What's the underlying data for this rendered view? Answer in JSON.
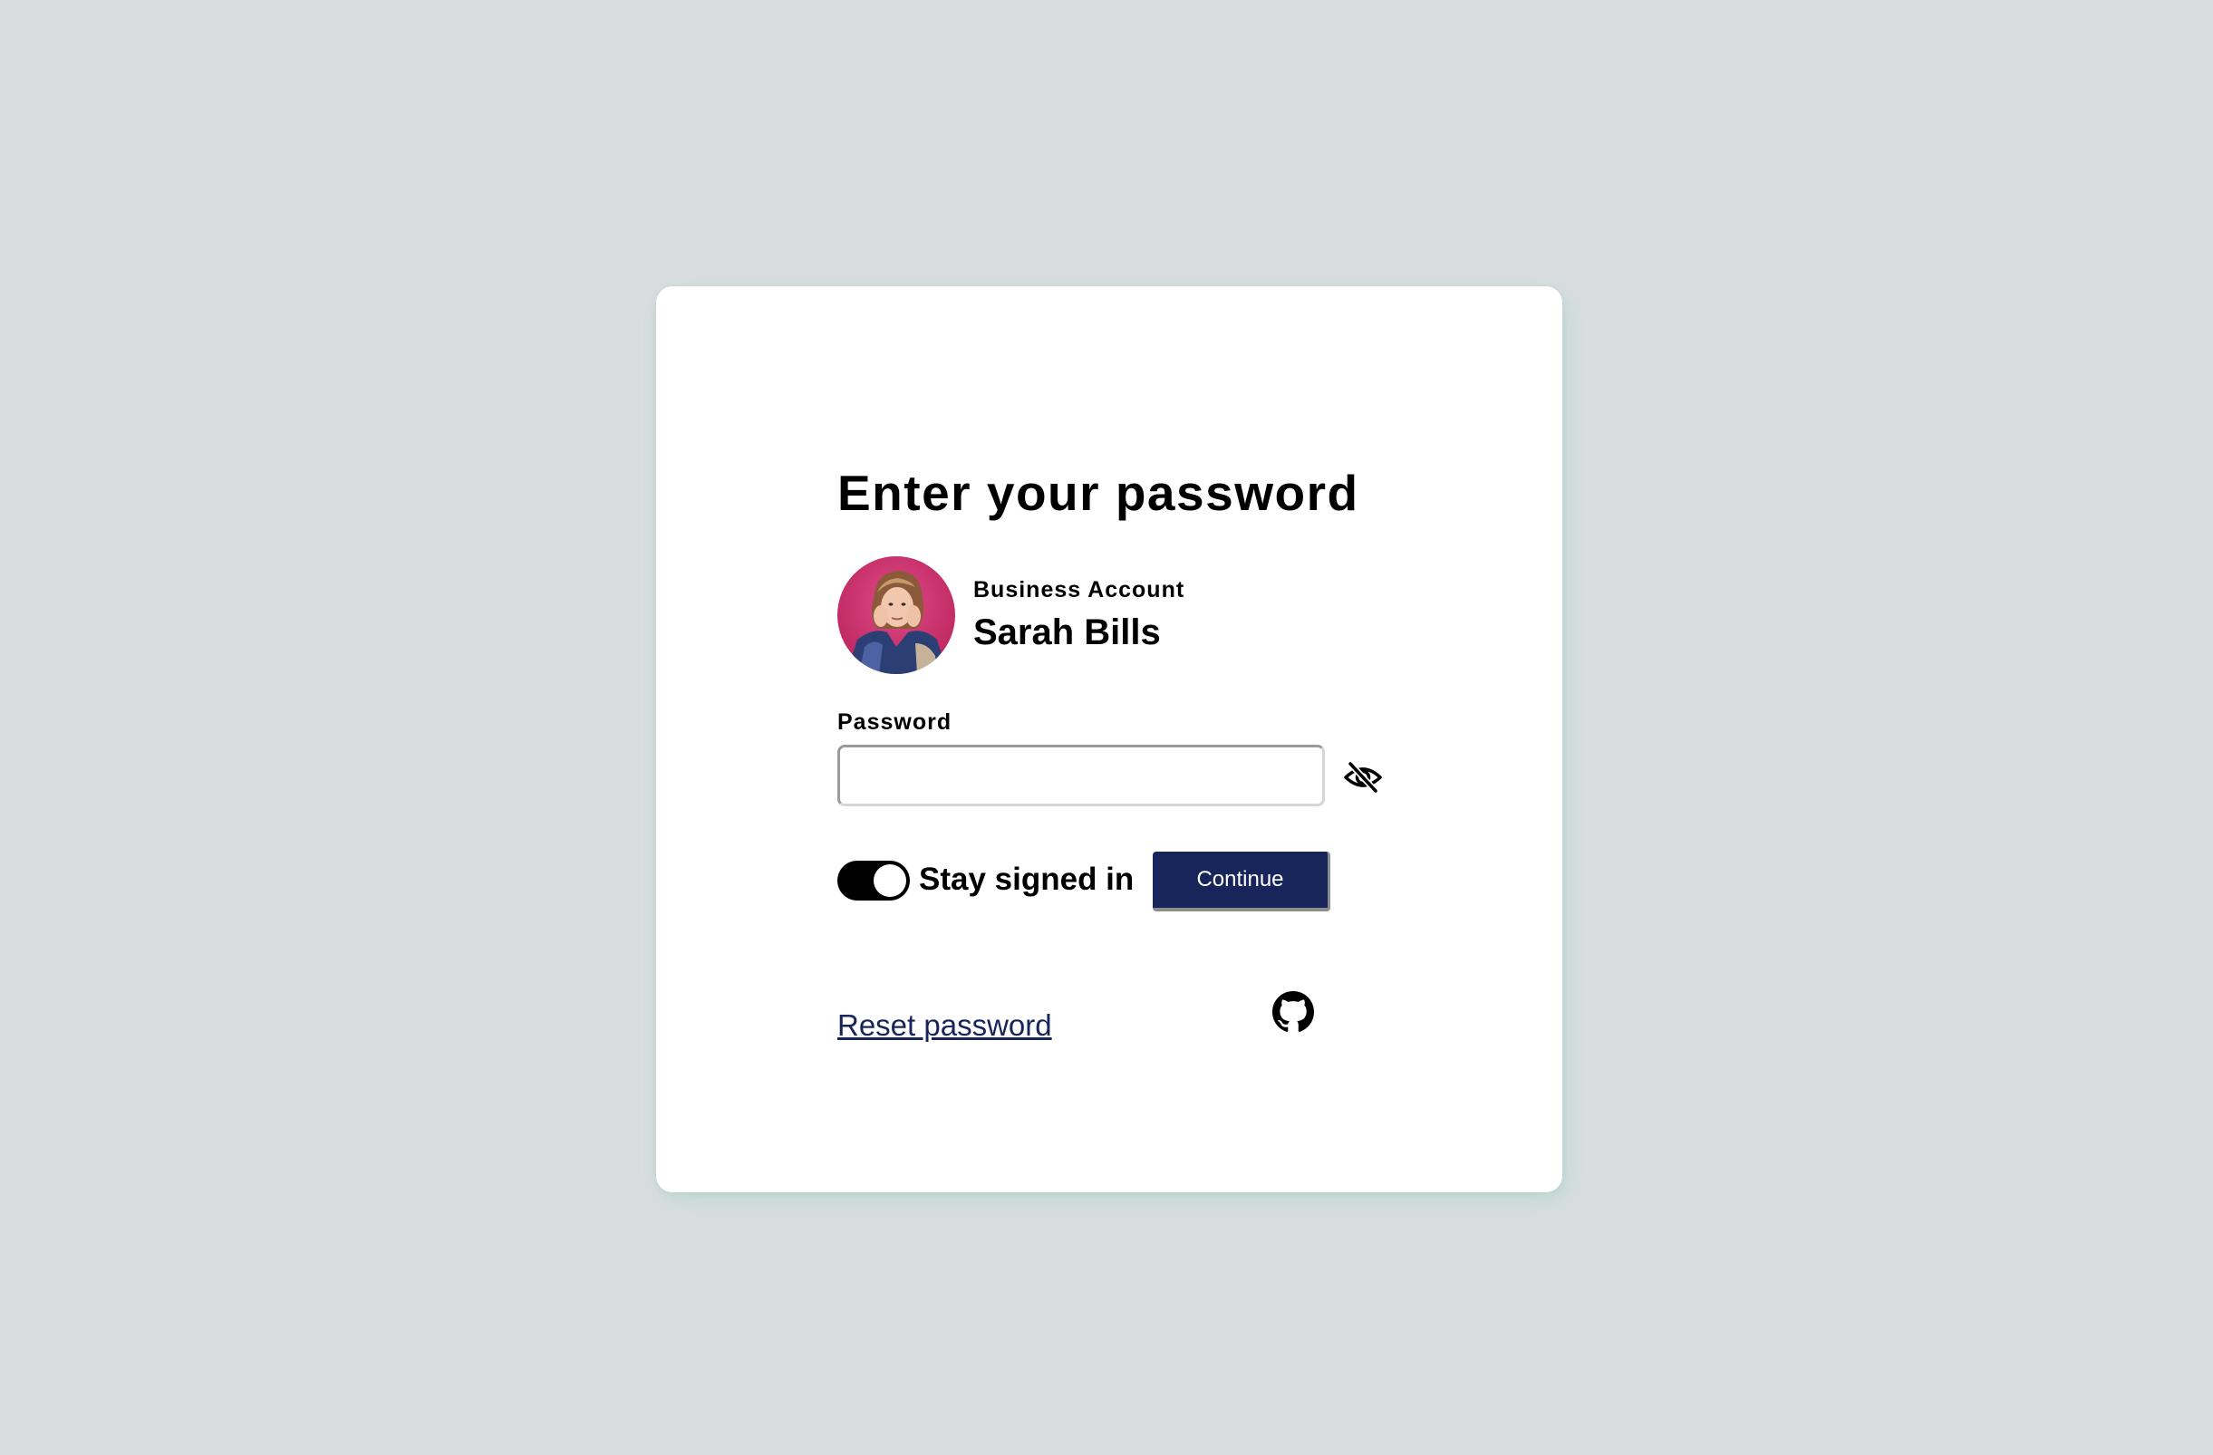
{
  "card": {
    "title": "Enter your password",
    "account": {
      "type": "Business Account",
      "name": "Sarah Bills"
    },
    "password": {
      "label": "Password",
      "value": "",
      "placeholder": "",
      "visibility_icon": "eye-slash-icon"
    },
    "stay_signed_in": {
      "label": "Stay signed in",
      "checked": true
    },
    "continue_label": "Continue",
    "reset_link": "Reset password",
    "social_icon": "github-icon"
  },
  "colors": {
    "background": "#d9dddf",
    "card": "#ffffff",
    "primary": "#17255a",
    "text": "#000000"
  }
}
